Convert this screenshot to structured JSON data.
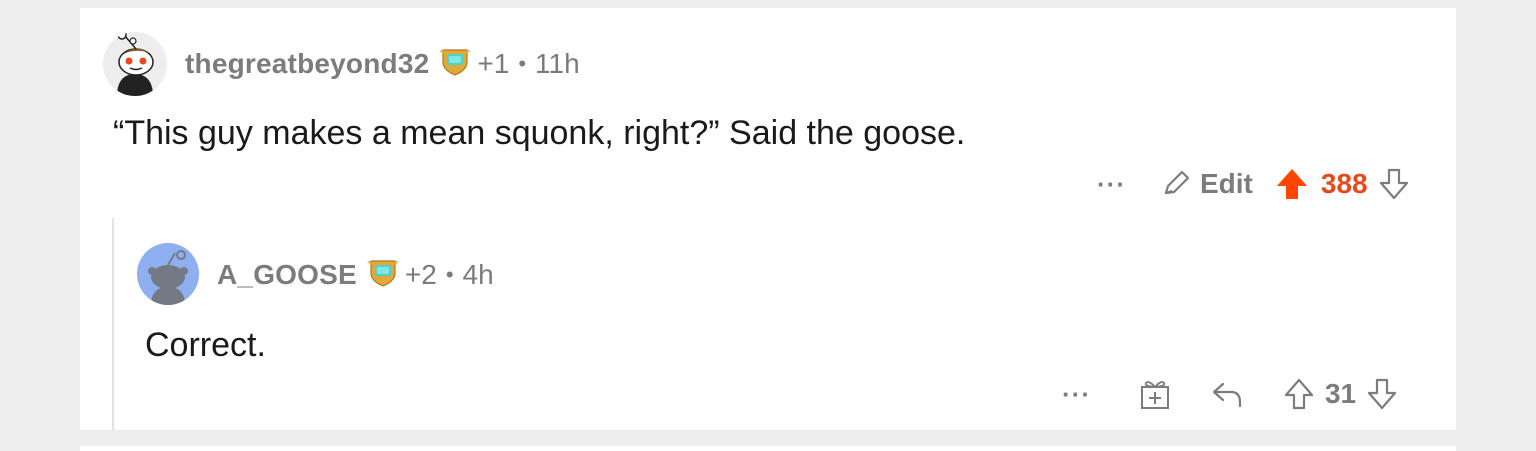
{
  "comments": [
    {
      "username": "thegreatbeyond32",
      "award_count": "+1",
      "time": "11h",
      "body": "“This guy makes a mean squonk, right?” Said the goose.",
      "actions": {
        "more": "···",
        "edit_label": "Edit",
        "score": "388",
        "upvoted": true
      }
    },
    {
      "username": "A_GOOSE",
      "award_count": "+2",
      "time": "4h",
      "body": "Correct.",
      "actions": {
        "more": "···",
        "score": "31",
        "upvoted": false
      }
    }
  ],
  "separator": "•",
  "colors": {
    "upvote_active": "#e64a19",
    "muted_text": "#7c7c7c",
    "card_bg": "#ffffff",
    "page_bg": "#ededed",
    "reply_avatar_bg": "#8fb0f0"
  },
  "icons": [
    "snoo-avatar-icon",
    "award-badge-icon",
    "pencil-icon",
    "upvote-arrow-icon",
    "downvote-arrow-icon",
    "gift-icon",
    "reply-arrow-icon"
  ]
}
